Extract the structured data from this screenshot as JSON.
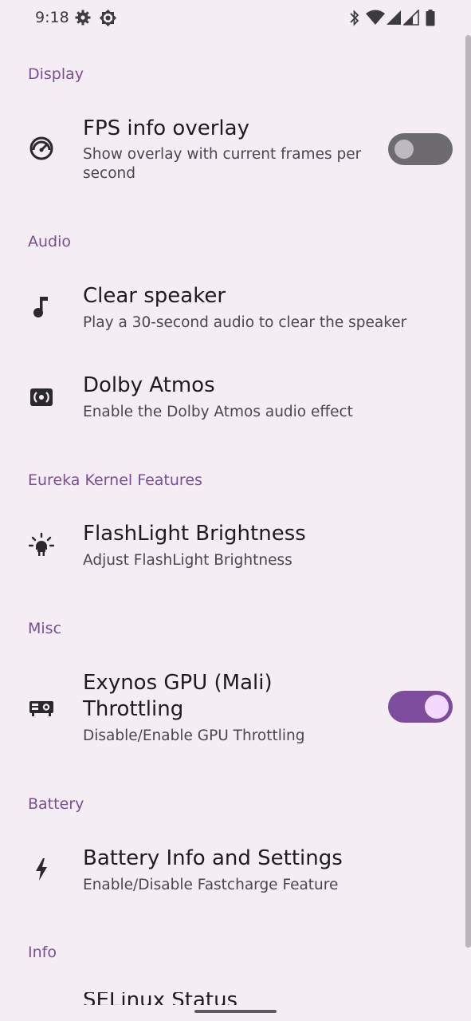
{
  "status_bar": {
    "time": "9:18",
    "left_icons": [
      "gear-icon",
      "brightness-icon"
    ],
    "right_icons": [
      "bluetooth-icon",
      "wifi-icon",
      "signal-icon",
      "signal-icon-2",
      "battery-icon"
    ]
  },
  "sections": {
    "display": {
      "header": "Display",
      "items": [
        {
          "title": "FPS info overlay",
          "subtitle_line1": "Show overlay with current frames per",
          "subtitle_line2": "second",
          "icon": "speedometer-icon",
          "toggle_on": false
        }
      ]
    },
    "audio": {
      "header": "Audio",
      "items": [
        {
          "title": "Clear speaker",
          "subtitle": "Play a 30-second audio to clear the speaker",
          "icon": "music-note-icon"
        },
        {
          "title": "Dolby Atmos",
          "subtitle": "Enable the Dolby Atmos audio effect",
          "icon": "surround-sound-icon"
        }
      ]
    },
    "eureka": {
      "header": "Eureka Kernel Features",
      "items": [
        {
          "title": "FlashLight Brightness",
          "subtitle": "Adjust FlashLight Brightness",
          "icon": "flashlight-icon"
        }
      ]
    },
    "misc": {
      "header": "Misc",
      "items": [
        {
          "title_line1": "Exynos GPU (Mali)",
          "title_line2": "Throttling",
          "subtitle": "Disable/Enable GPU Throttling",
          "icon": "gpu-icon",
          "toggle_on": true
        }
      ]
    },
    "battery": {
      "header": "Battery",
      "items": [
        {
          "title": "Battery Info and Settings",
          "subtitle": "Enable/Disable Fastcharge Feature",
          "icon": "bolt-icon"
        }
      ]
    },
    "info": {
      "header": "Info",
      "partial_item_title": "SELinux Status"
    }
  },
  "colors": {
    "background": "#f4eef4",
    "accent": "#7a4d95",
    "toggle_on": "#7d4c9c",
    "toggle_off": "#6d6a70"
  }
}
